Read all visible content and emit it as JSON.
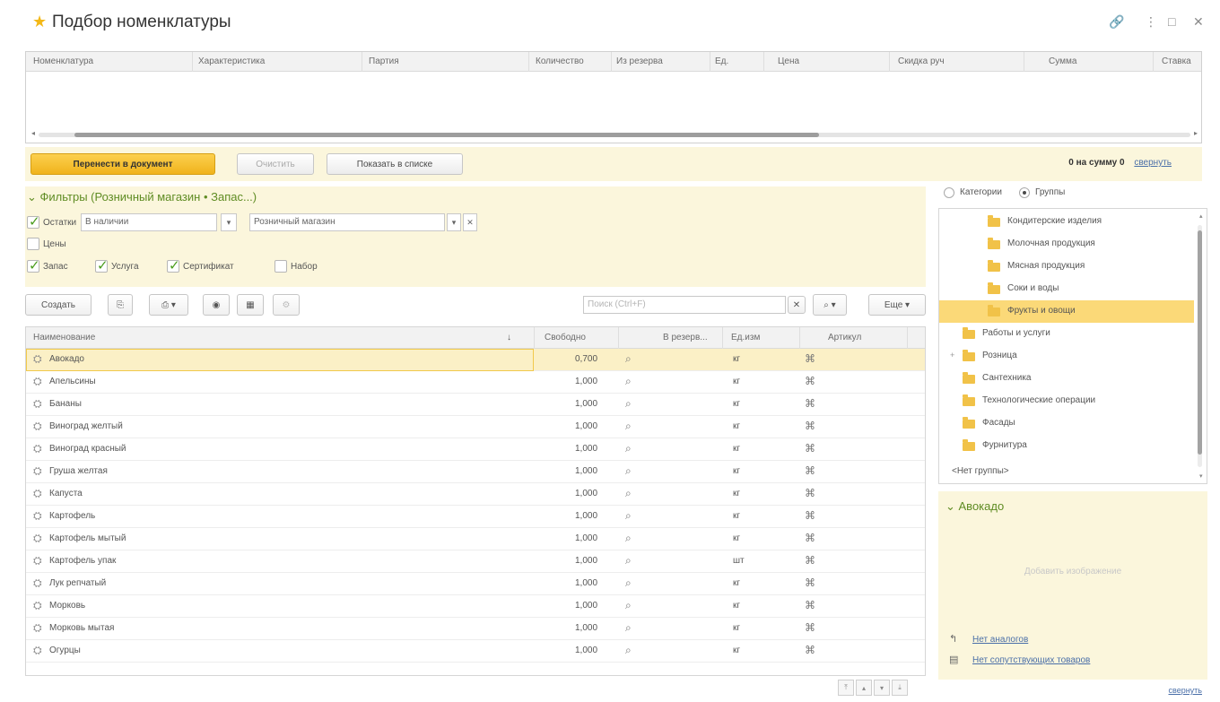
{
  "window": {
    "title": "Подбор номенклатуры",
    "controls": [
      "🔗",
      "⋮",
      "□",
      "✕"
    ]
  },
  "selected_table": {
    "columns": [
      "Номенклатура",
      "Характеристика",
      "Партия",
      "Количество",
      "Из резерва",
      "Ед.",
      "Цена",
      "Скидка руч",
      "Сумма",
      "Ставка"
    ]
  },
  "actions": {
    "transfer": "Перенести в документ",
    "clear": "Очистить",
    "show_list": "Показать в списке",
    "summary": "0 на сумму 0",
    "collapse": "свернуть"
  },
  "filters": {
    "title": "Фильтры (Розничный магазин • Запас...)",
    "stock": {
      "label": "Остатки",
      "checked": true,
      "mode": "В наличии",
      "warehouse": "Розничный магазин"
    },
    "prices": {
      "label": "Цены",
      "checked": false
    },
    "types": [
      {
        "label": "Запас",
        "checked": true
      },
      {
        "label": "Услуга",
        "checked": true
      },
      {
        "label": "Сертификат",
        "checked": true
      },
      {
        "label": "Набор",
        "checked": false
      }
    ]
  },
  "toolbar": {
    "create": "Создать",
    "search_placeholder": "Поиск (Ctrl+F)",
    "more": "Еще"
  },
  "list": {
    "columns": [
      "Наименование",
      "Свободно",
      "В резерв...",
      "Ед.изм",
      "Артикул"
    ],
    "rows": [
      {
        "name": "Авокадо",
        "free": "0,700",
        "unit": "кг"
      },
      {
        "name": "Апельсины",
        "free": "1,000",
        "unit": "кг"
      },
      {
        "name": "Бананы",
        "free": "1,000",
        "unit": "кг"
      },
      {
        "name": "Виноград желтый",
        "free": "1,000",
        "unit": "кг"
      },
      {
        "name": "Виноград красный",
        "free": "1,000",
        "unit": "кг"
      },
      {
        "name": "Груша желтая",
        "free": "1,000",
        "unit": "кг"
      },
      {
        "name": "Капуста",
        "free": "1,000",
        "unit": "кг"
      },
      {
        "name": "Картофель",
        "free": "1,000",
        "unit": "кг"
      },
      {
        "name": "Картофель мытый",
        "free": "1,000",
        "unit": "кг"
      },
      {
        "name": "Картофель упак",
        "free": "1,000",
        "unit": "шт"
      },
      {
        "name": "Лук репчатый",
        "free": "1,000",
        "unit": "кг"
      },
      {
        "name": "Морковь",
        "free": "1,000",
        "unit": "кг"
      },
      {
        "name": "Морковь мытая",
        "free": "1,000",
        "unit": "кг"
      },
      {
        "name": "Огурцы",
        "free": "1,000",
        "unit": "кг"
      }
    ]
  },
  "grouping": {
    "categories": "Категории",
    "groups": "Группы",
    "selected": "Группы"
  },
  "tree": {
    "items": [
      {
        "label": "Кондитерские изделия",
        "level": 2
      },
      {
        "label": "Молочная продукция",
        "level": 2
      },
      {
        "label": "Мясная продукция",
        "level": 2
      },
      {
        "label": "Соки и воды",
        "level": 2
      },
      {
        "label": "Фрукты и овощи",
        "level": 2,
        "selected": true
      },
      {
        "label": "Работы и услуги",
        "level": 1
      },
      {
        "label": "Розница",
        "level": 1,
        "expandable": true
      },
      {
        "label": "Сантехника",
        "level": 1
      },
      {
        "label": "Технологические операции",
        "level": 1
      },
      {
        "label": "Фасады",
        "level": 1
      },
      {
        "label": "Фурнитура",
        "level": 1
      }
    ],
    "no_group": "<Нет группы>"
  },
  "card": {
    "title": "Авокадо",
    "add_image": "Добавить изображение",
    "analogs": "Нет аналогов",
    "related": "Нет сопутствующих товаров"
  },
  "footer": {
    "collapse": "свернуть"
  },
  "colors": {
    "accent_yellow": "#f0b31c",
    "panel_bg": "#fbf6dc",
    "green_title": "#5f8c23",
    "link": "#4a6fa8"
  }
}
